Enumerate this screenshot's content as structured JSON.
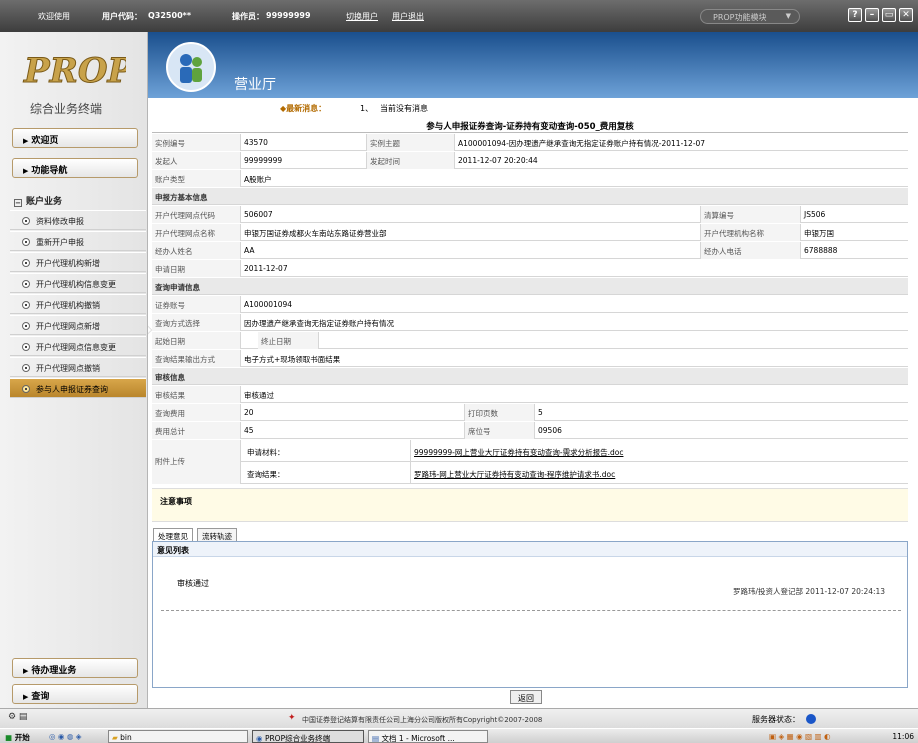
{
  "topbar": {
    "welcome": "欢迎使用",
    "user_code_label": "用户代码：",
    "user_code_value": "Q32500**",
    "operator_label": "操作员：",
    "operator_value": "99999999",
    "switch_user": "切换用户",
    "logout": "用户退出",
    "module_select": "PROP功能模块",
    "window_buttons": [
      "?",
      "–",
      "▭",
      "✕"
    ]
  },
  "sidebar": {
    "logo_text": "PROP",
    "subtitle": "综合业务终端",
    "welcome": "欢迎页",
    "nav": "功能导航",
    "account_section": "账户业务",
    "items": [
      "资料修改申报",
      "重新开户申报",
      "开户代理机构新增",
      "开户代理机构信息变更",
      "开户代理机构撤销",
      "开户代理网点新增",
      "开户代理网点信息变更",
      "开户代理网点撤销",
      "参与人申报证券查询"
    ],
    "active_index": 8,
    "pending": "待办理业务",
    "query": "查询"
  },
  "header": {
    "title": "营业厅",
    "news_label": "◆最新消息：",
    "news_index": "1、",
    "news_text": "当前没有消息"
  },
  "form": {
    "title": "参与人申报证券查询-证券持有变动查询-050_费用复核",
    "instance_no_label": "实例编号",
    "instance_no": "43570",
    "instance_subject_label": "实例主题",
    "instance_subject": "A100001094-因办理遗产继承查询无指定证券账户持有情况-2011-12-07",
    "initiator_label": "发起人",
    "initiator": "99999999",
    "start_time_label": "发起时间",
    "start_time": "2011-12-07 20:20:44",
    "account_type_label": "账户类型",
    "account_type": "A股账户",
    "basic_section": "申报方基本信息",
    "agent_code_label": "开户代理网点代码",
    "agent_code": "506007",
    "clearing_no_label": "清算编号",
    "clearing_no": "JS506",
    "agent_name_label": "开户代理网点名称",
    "agent_name": "申银万国证券成都火车南站东路证券营业部",
    "agency_name_label": "开户代理机构名称",
    "agency_name": "申银万国",
    "handler_label": "经办人姓名",
    "handler": "AA",
    "handler_phone_label": "经办人电话",
    "handler_phone": "6788888",
    "apply_date_label": "申请日期",
    "apply_date": "2011-12-07",
    "query_section": "查询申请信息",
    "sec_account_label": "证券账号",
    "sec_account": "A100001094",
    "query_method_label": "查询方式选择",
    "query_method": "因办理遗产继承查询无指定证券账户持有情况",
    "start_date_label": "起始日期",
    "end_date_label": "终止日期",
    "output_method_label": "查询结果输出方式",
    "output_method": "电子方式+现场领取书面结果",
    "review_section": "审核信息",
    "review_result_label": "审核结果",
    "review_result": "审核通过",
    "query_fee_label": "查询费用",
    "query_fee": "20",
    "print_pages_label": "打印页数",
    "print_pages": "5",
    "total_fee_label": "费用总计",
    "total_fee": "45",
    "seat_no_label": "席位号",
    "seat_no": "09506",
    "attachment_label": "附件上传",
    "apply_material_label": "申请材料：",
    "apply_material_file": "99999999-网上营业大厅证券持有变动查询-需求分析报告.doc",
    "query_result_label": "查询结果：",
    "query_result_file": "罗路玮-网上营业大厅证券持有变动查询-程序维护请求书.doc"
  },
  "notes": {
    "title": "注意事项"
  },
  "tabs": [
    "处理意见",
    "流转轨迹"
  ],
  "opinion": {
    "header": "意见列表",
    "text": "审核通过",
    "by": "罗路玮/投资人登记部 2011-12-07 20:24:13"
  },
  "back_button": "返回",
  "footer": {
    "copyright": "中国证券登记结算有限责任公司上海分公司版权所有Copyright©2007-2008",
    "server_status": "服务器状态："
  },
  "taskbar": {
    "start": "开始",
    "tasks": [
      "bin",
      "PROP综合业务终端",
      "文档 1 - Microsoft ..."
    ],
    "clock": "11:06"
  },
  "colors": {
    "banner": "#1a4f8d",
    "active_menu": "#c99638",
    "section_bg": "#e9e9e9"
  }
}
